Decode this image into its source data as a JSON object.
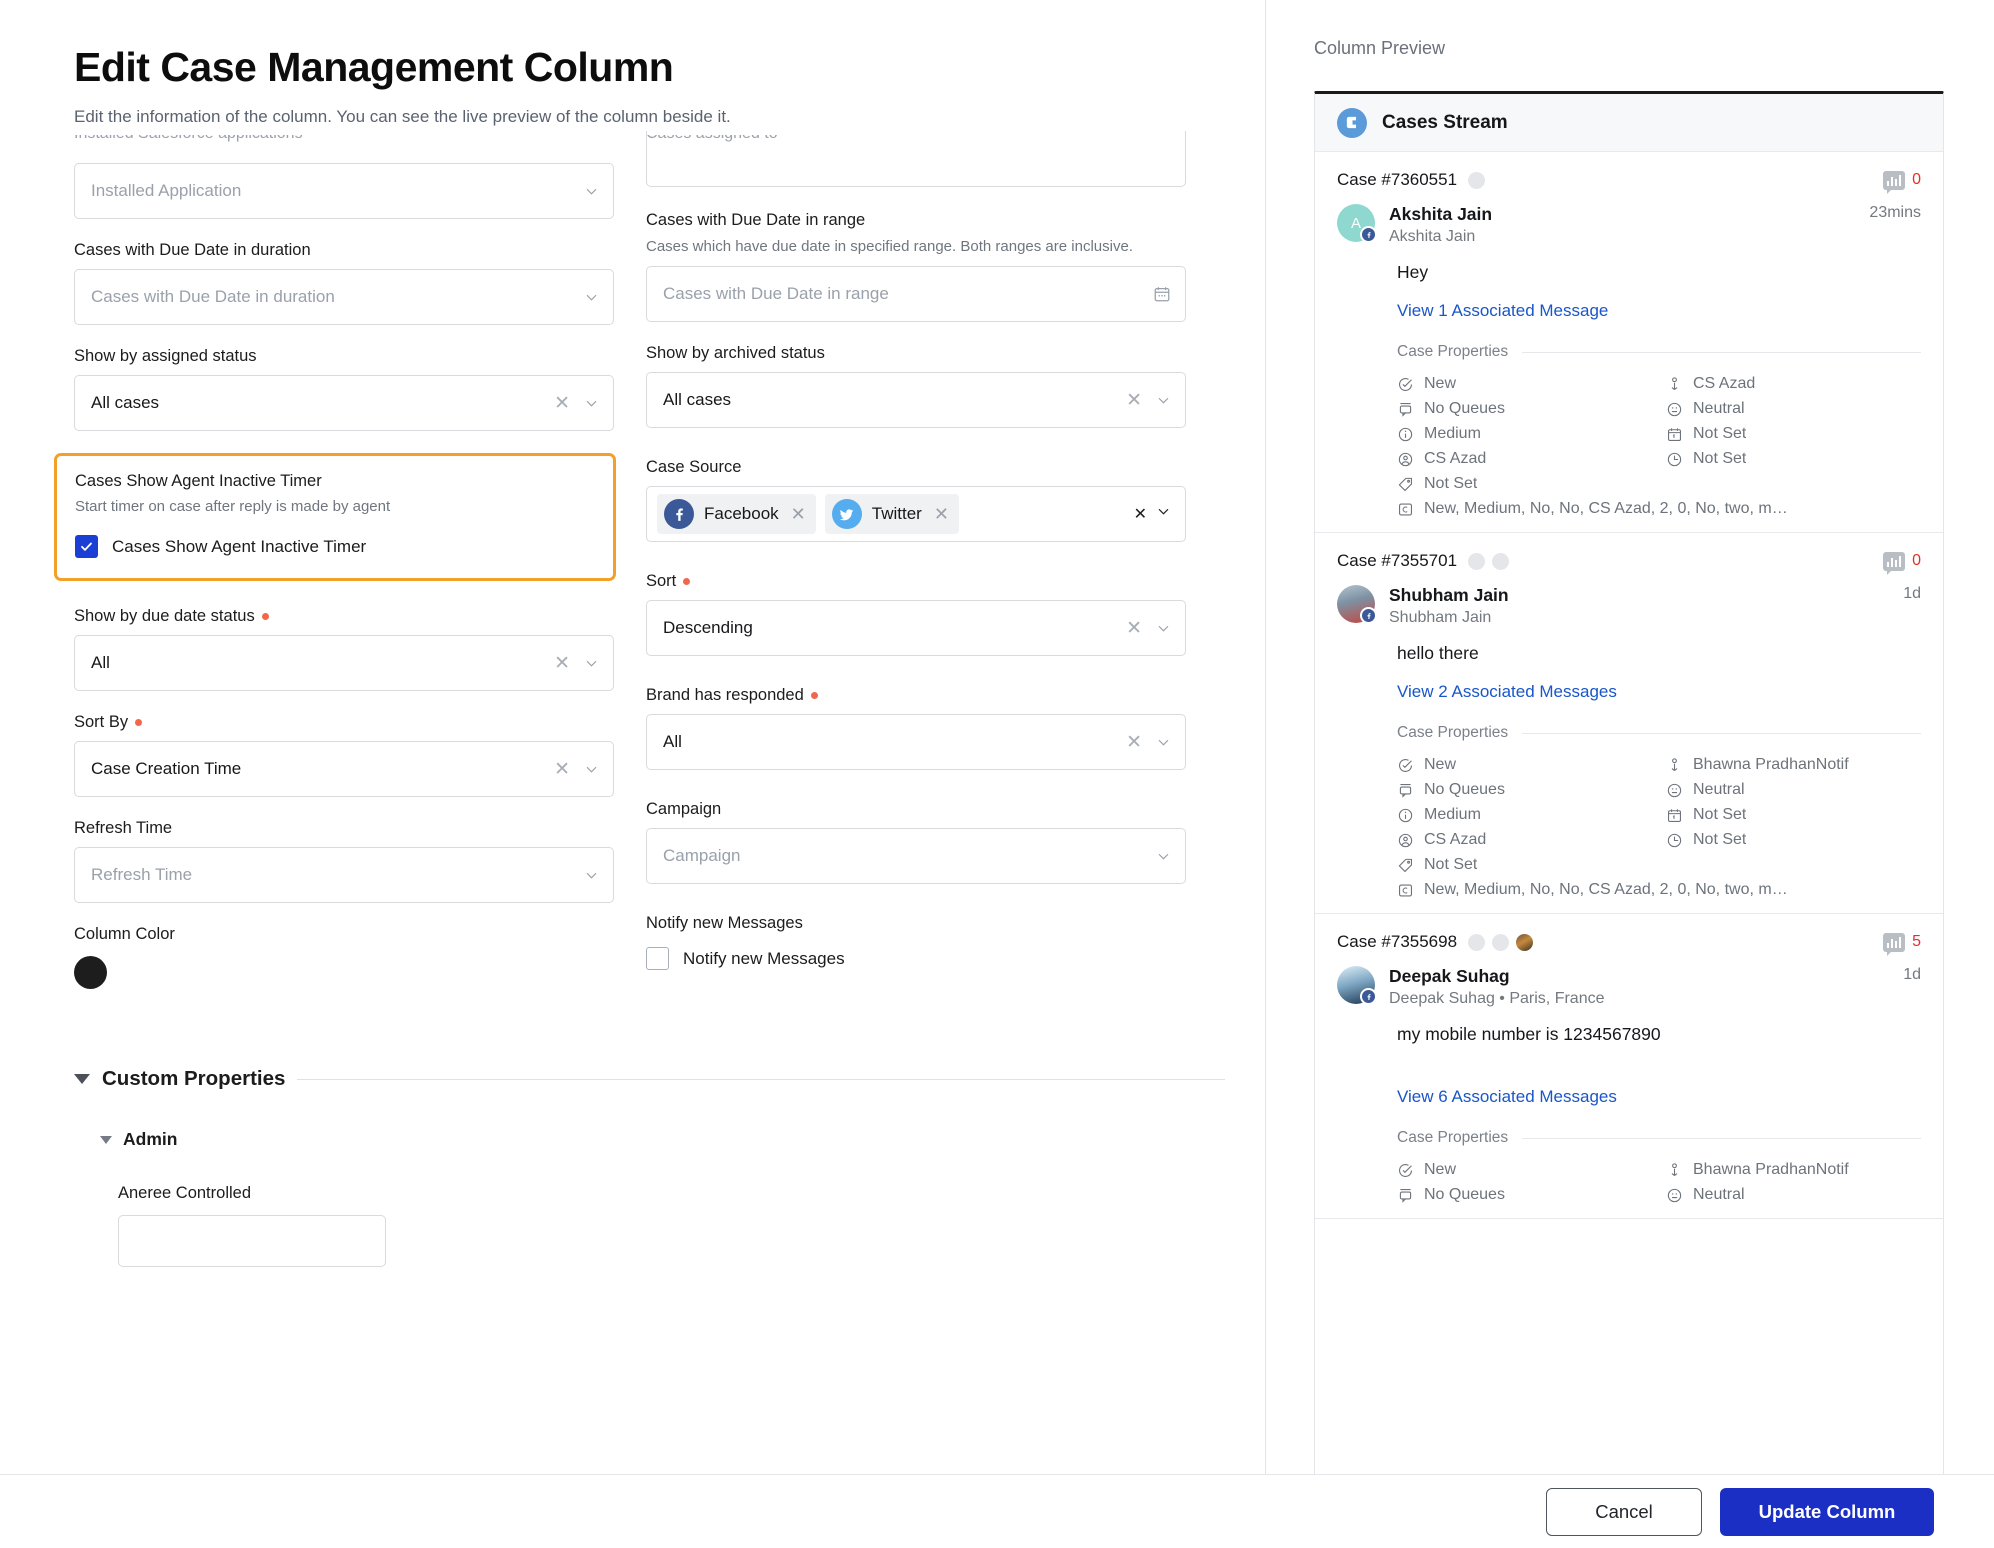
{
  "header": {
    "title": "Edit Case Management Column",
    "subtitle": "Edit the information of the column. You can see the live preview of the column beside it."
  },
  "form": {
    "left": {
      "clipped_label": "Installed Salesforce applications",
      "installed_application": {
        "label": "",
        "value": "Installed Application"
      },
      "due_date_duration": {
        "label": "Cases with Due Date in duration",
        "placeholder": "Cases with Due Date in duration"
      },
      "assigned_status": {
        "label": "Show by assigned status",
        "value": "All cases"
      },
      "inactive_timer": {
        "title": "Cases Show Agent Inactive Timer",
        "help": "Start timer on case after reply is made by agent",
        "checkbox_label": "Cases Show Agent Inactive Timer",
        "checked": true,
        "highlight_color": "#f3a02a"
      },
      "due_date_status": {
        "label": "Show by due date status",
        "required": true,
        "value": "All"
      },
      "sort_by": {
        "label": "Sort By",
        "required": true,
        "value": "Case Creation Time"
      },
      "refresh_time": {
        "label": "Refresh Time",
        "placeholder": "Refresh Time"
      },
      "column_color": {
        "label": "Column Color",
        "color": "#1d1d1d"
      }
    },
    "right": {
      "clipped_label": "Cases assigned to",
      "due_date_range": {
        "label": "Cases with Due Date in range",
        "help": "Cases which have due date in specified range. Both ranges are inclusive.",
        "placeholder": "Cases with Due Date in range"
      },
      "archived_status": {
        "label": "Show by archived status",
        "value": "All cases"
      },
      "case_source": {
        "label": "Case Source",
        "tags": [
          {
            "name": "Facebook",
            "icon": "facebook-icon",
            "color": "#3b5998"
          },
          {
            "name": "Twitter",
            "icon": "twitter-icon",
            "color": "#55acee"
          }
        ]
      },
      "sort": {
        "label": "Sort",
        "required": true,
        "value": "Descending"
      },
      "brand_responded": {
        "label": "Brand has responded",
        "required": true,
        "value": "All"
      },
      "campaign": {
        "label": "Campaign",
        "placeholder": "Campaign"
      },
      "notify_new_messages": {
        "label": "Notify new Messages",
        "checkbox_label": "Notify new Messages",
        "checked": false
      }
    },
    "custom_properties": {
      "title": "Custom Properties",
      "group": "Admin",
      "property_label": "Aneree Controlled"
    }
  },
  "preview": {
    "title": "Column Preview",
    "stream_name": "Cases Stream",
    "properties_heading": "Case Properties",
    "cases": [
      {
        "case_id": "Case #7360551",
        "dots": [
          "plain"
        ],
        "sentiment_count": "0",
        "author": "Akshita Jain",
        "author_sub": "Akshita Jain",
        "avatar_initial": "A",
        "avatar_type": "teal",
        "time": "23mins",
        "message": "Hey",
        "associated": "View 1 Associated Message",
        "properties": [
          {
            "icon": "status-icon",
            "text": "New"
          },
          {
            "icon": "assignee-icon",
            "text": "CS Azad"
          },
          {
            "icon": "queue-icon",
            "text": "No Queues"
          },
          {
            "icon": "sentiment-icon",
            "text": "Neutral"
          },
          {
            "icon": "priority-icon",
            "text": "Medium"
          },
          {
            "icon": "calendar-icon",
            "text": "Not Set"
          },
          {
            "icon": "user-icon",
            "text": "CS Azad"
          },
          {
            "icon": "clock-icon",
            "text": "Not Set"
          },
          {
            "icon": "tag-icon",
            "text": "Not Set"
          }
        ],
        "custom_row": {
          "icon": "custom-icon",
          "text": "New, Medium, No, No, CS Azad, 2, 0, No, two, m…"
        }
      },
      {
        "case_id": "Case #7355701",
        "dots": [
          "plain",
          "plain"
        ],
        "sentiment_count": "0",
        "author": "Shubham Jain",
        "author_sub": "Shubham Jain",
        "avatar_initial": "",
        "avatar_type": "photo1",
        "time": "1d",
        "message": "hello there",
        "associated": "View 2 Associated Messages",
        "properties": [
          {
            "icon": "status-icon",
            "text": "New"
          },
          {
            "icon": "assignee-icon",
            "text": "Bhawna PradhanNotif"
          },
          {
            "icon": "queue-icon",
            "text": "No Queues"
          },
          {
            "icon": "sentiment-icon",
            "text": "Neutral"
          },
          {
            "icon": "priority-icon",
            "text": "Medium"
          },
          {
            "icon": "calendar-icon",
            "text": "Not Set"
          },
          {
            "icon": "user-icon",
            "text": "CS Azad"
          },
          {
            "icon": "clock-icon",
            "text": "Not Set"
          },
          {
            "icon": "tag-icon",
            "text": "Not Set"
          }
        ],
        "custom_row": {
          "icon": "custom-icon",
          "text": "New, Medium, No, No, CS Azad, 2, 0, No, two, m…"
        }
      },
      {
        "case_id": "Case #7355698",
        "dots": [
          "plain",
          "plain",
          "image"
        ],
        "sentiment_count": "5",
        "author": "Deepak Suhag",
        "author_sub": "Deepak Suhag • Paris, France",
        "avatar_initial": "",
        "avatar_type": "photo2",
        "time": "1d",
        "message": "my mobile number is 1234567890",
        "associated": "View 6 Associated Messages",
        "properties": [
          {
            "icon": "status-icon",
            "text": "New"
          },
          {
            "icon": "assignee-icon",
            "text": "Bhawna PradhanNotif"
          },
          {
            "icon": "queue-icon",
            "text": "No Queues"
          },
          {
            "icon": "sentiment-icon",
            "text": "Neutral"
          }
        ],
        "custom_row": null
      }
    ]
  },
  "footer": {
    "cancel_label": "Cancel",
    "update_label": "Update Column",
    "primary_color": "#1b2fc4"
  }
}
